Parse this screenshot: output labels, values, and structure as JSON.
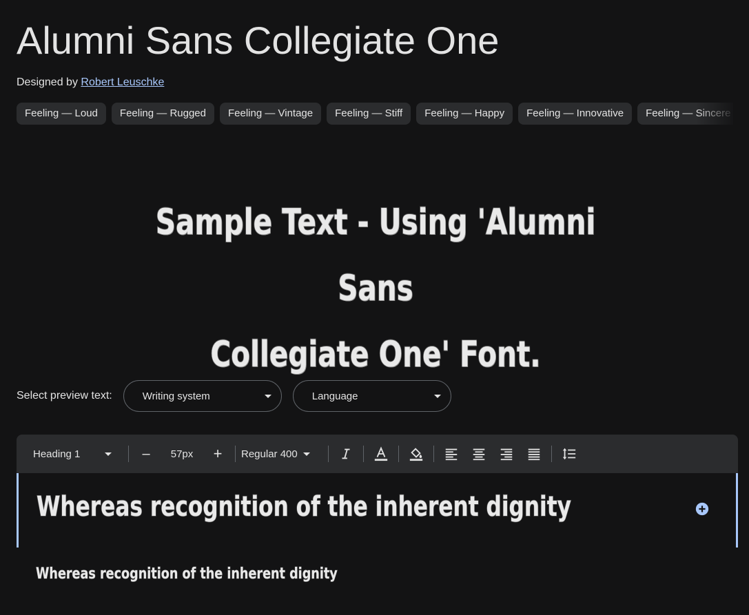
{
  "header": {
    "title": "Alumni Sans Collegiate One",
    "designed_by_label": "Designed by",
    "designer": "Robert Leuschke"
  },
  "tags": [
    "Feeling — Loud",
    "Feeling — Rugged",
    "Feeling — Vintage",
    "Feeling — Stiff",
    "Feeling — Happy",
    "Feeling — Innovative",
    "Feeling — Sincere"
  ],
  "hero": {
    "line1": "Sample Text - Using 'Alumni Sans",
    "line2": "Collegiate One' Font."
  },
  "preview": {
    "label": "Select preview text:",
    "writing_system": "Writing system",
    "language": "Language"
  },
  "toolbar": {
    "style": "Heading 1",
    "size": "57px",
    "weight": "Regular 400",
    "decrease": "–",
    "increase": "+"
  },
  "editor": {
    "big_text": "Whereas recognition of the inherent dignity",
    "small_text": "Whereas recognition of the inherent dignity"
  },
  "colors": {
    "background": "#131314",
    "accent": "#a8c7fa",
    "chip": "#2b2c2e"
  }
}
